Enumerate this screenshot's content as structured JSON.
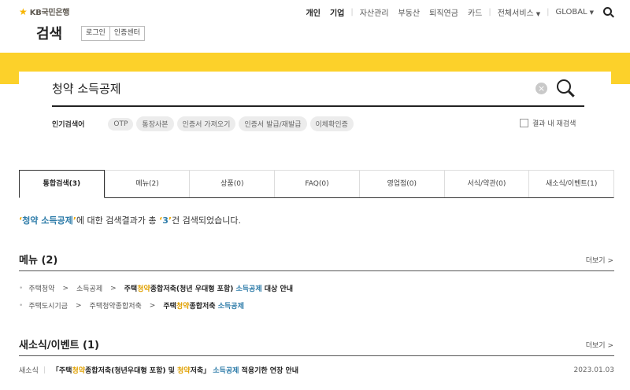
{
  "brand": {
    "logo_text": "KB국민은행",
    "accent": "#fcd12a",
    "link_color": "#2e7ca9"
  },
  "header": {
    "page_title": "검색",
    "util_buttons": [
      "로그인",
      "인증센터"
    ],
    "gnb": [
      "개인",
      "기업",
      "자산관리",
      "부동산",
      "퇴직연금",
      "카드",
      "전체서비스",
      "GLOBAL"
    ]
  },
  "search": {
    "query": "청약 소득공제",
    "popular_label": "인기검색어",
    "popular_keywords": [
      "OTP",
      "통장사본",
      "인증서 가져오기",
      "인증서 발급/재발급",
      "이체확인증"
    ],
    "within_results_label": "결과 내 재검색"
  },
  "tabs": [
    "통합검색(3)",
    "메뉴(2)",
    "상품(0)",
    "FAQ(0)",
    "영업점(0)",
    "서식/약관(0)",
    "새소식/이벤트(1)"
  ],
  "summary": {
    "open_quote": "‘",
    "keyword": "청약 소득공제",
    "close_quote": "’",
    "middle": "에 대한 검색결과가 총 ",
    "count": "3",
    "end": "건 검색되었습니다."
  },
  "menu_section": {
    "title": "메뉴 (2)",
    "more": "더보기 >",
    "rows": [
      {
        "path": [
          "주택청약",
          "소득공제"
        ],
        "final_pre": "주택",
        "final_hl1": "청약",
        "final_mid": "종합저축(청년 우대형 포함) ",
        "final_hl2": "소득공제",
        "final_post": " 대상 안내"
      },
      {
        "path": [
          "주택도시기금",
          "주택청약종합저축"
        ],
        "final_pre": "주택",
        "final_hl1": "청약",
        "final_mid": "종합저축 ",
        "final_hl2": "소득공제",
        "final_post": ""
      }
    ]
  },
  "news_section": {
    "title": "새소식/이벤트 (1)",
    "more": "더보기 >",
    "category": "새소식",
    "title_pre": "「주택",
    "title_hl1": "청약",
    "title_mid": "종합저축(청년우대형 포함) 및 ",
    "title_hl2": "청약",
    "title_mid2": "저축」 ",
    "title_hl3": "소득공제",
    "title_post": " 적용기한 연장 안내",
    "date": "2023.01.03"
  }
}
